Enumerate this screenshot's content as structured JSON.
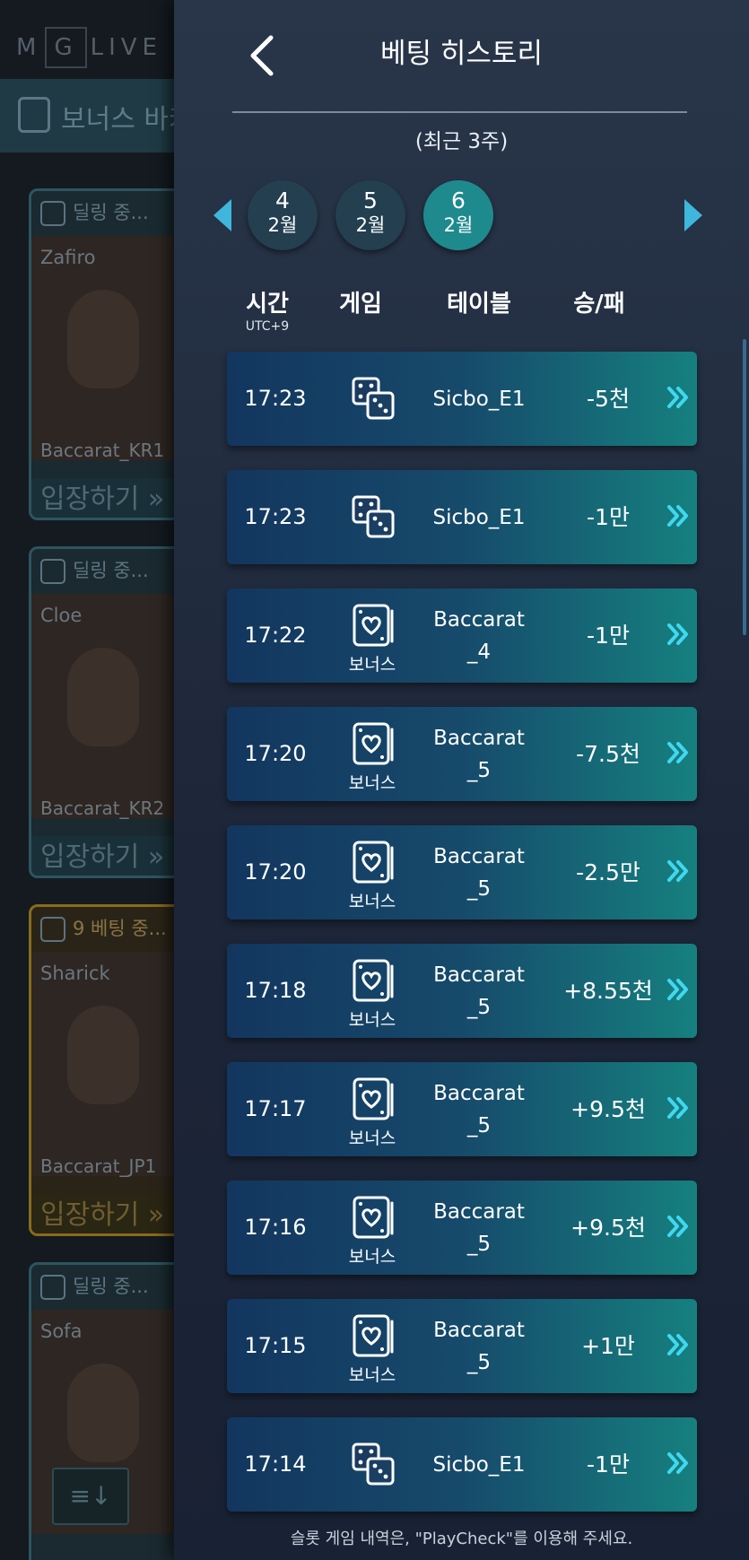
{
  "background": {
    "logo": {
      "left": "M",
      "middle": "G",
      "right": "LIVE"
    },
    "bonus_bar_label": "보너스 바카",
    "cards": [
      {
        "status": "딜링 중...",
        "dealer": "Zafiro",
        "table": "Baccarat_KR1",
        "enter": "입장하기 »",
        "variant": "normal"
      },
      {
        "status": "딜링 중...",
        "dealer": "Cloe",
        "table": "Baccarat_KR2",
        "enter": "입장하기 »",
        "variant": "normal"
      },
      {
        "status": "9  베팅 중...",
        "dealer": "Sharick",
        "table": "Baccarat_JP1",
        "enter": "입장하기 »",
        "variant": "gold"
      },
      {
        "status": "딜링 중...",
        "dealer": "Sofa",
        "table": "",
        "enter": "",
        "variant": "normal"
      }
    ]
  },
  "header": {
    "title": "베팅 히스토리",
    "subtitle": "(최근 3주)"
  },
  "dates": [
    {
      "day": "4",
      "month": "2월",
      "active": false
    },
    {
      "day": "5",
      "month": "2월",
      "active": false
    },
    {
      "day": "6",
      "month": "2월",
      "active": true
    }
  ],
  "columns": {
    "time": "시간",
    "timezone": "UTC+9",
    "game": "게임",
    "table": "테이블",
    "result": "승/패"
  },
  "rows": [
    {
      "time": "17:23",
      "game_icon": "dice-icon",
      "game_label": "",
      "table": "Sicbo_E1",
      "result": "-5천"
    },
    {
      "time": "17:23",
      "game_icon": "dice-icon",
      "game_label": "",
      "table": "Sicbo_E1",
      "result": "-1만"
    },
    {
      "time": "17:22",
      "game_icon": "heart-card-icon",
      "game_label": "보너스",
      "table": "Baccarat\n_4",
      "result": "-1만"
    },
    {
      "time": "17:20",
      "game_icon": "heart-card-icon",
      "game_label": "보너스",
      "table": "Baccarat\n_5",
      "result": "-7.5천"
    },
    {
      "time": "17:20",
      "game_icon": "heart-card-icon",
      "game_label": "보너스",
      "table": "Baccarat\n_5",
      "result": "-2.5만"
    },
    {
      "time": "17:18",
      "game_icon": "heart-card-icon",
      "game_label": "보너스",
      "table": "Baccarat\n_5",
      "result": "+8.55천"
    },
    {
      "time": "17:17",
      "game_icon": "heart-card-icon",
      "game_label": "보너스",
      "table": "Baccarat\n_5",
      "result": "+9.5천"
    },
    {
      "time": "17:16",
      "game_icon": "heart-card-icon",
      "game_label": "보너스",
      "table": "Baccarat\n_5",
      "result": "+9.5천"
    },
    {
      "time": "17:15",
      "game_icon": "heart-card-icon",
      "game_label": "보너스",
      "table": "Baccarat\n_5",
      "result": "+1만"
    },
    {
      "time": "17:14",
      "game_icon": "dice-icon",
      "game_label": "",
      "table": "Sicbo_E1",
      "result": "-1만"
    }
  ],
  "footer_note": "슬롯 게임 내역은, \"PlayCheck\"를 이용해 주세요.",
  "colors": {
    "accent": "#3fb6dc",
    "active_date": "#1e8a8e"
  }
}
